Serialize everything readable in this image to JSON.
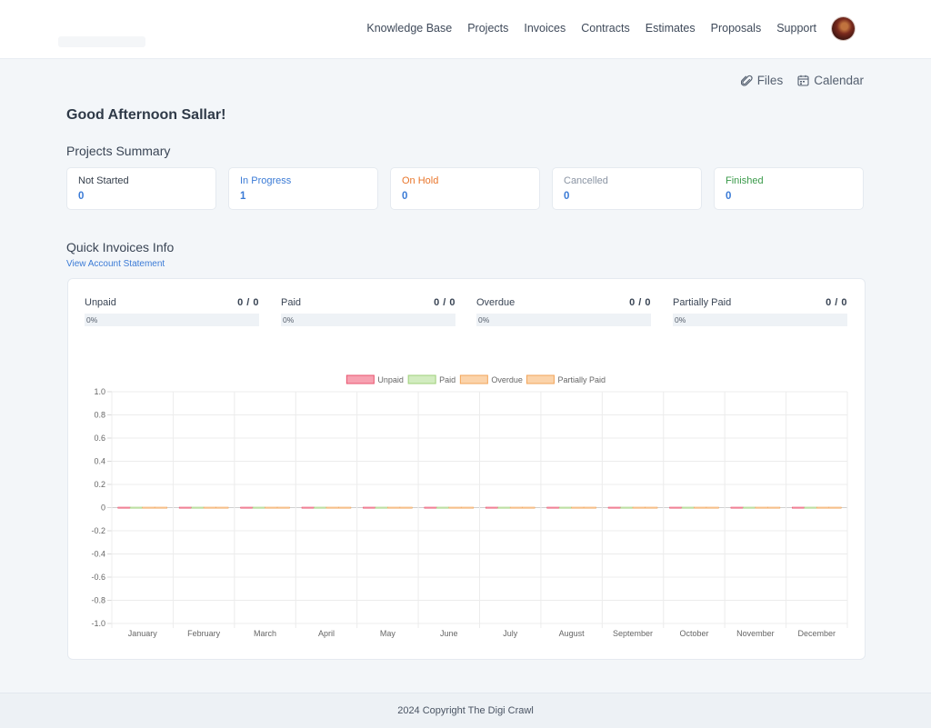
{
  "nav": {
    "items": [
      "Knowledge Base",
      "Projects",
      "Invoices",
      "Contracts",
      "Estimates",
      "Proposals",
      "Support"
    ]
  },
  "quicklinks": {
    "files": "Files",
    "calendar": "Calendar"
  },
  "greeting": "Good Afternoon Sallar!",
  "projects": {
    "title": "Projects Summary",
    "cards": [
      {
        "label": "Not Started",
        "value": "0",
        "color": "#333d4a"
      },
      {
        "label": "In Progress",
        "value": "1",
        "color": "#3b7bd6"
      },
      {
        "label": "On Hold",
        "value": "0",
        "color": "#e9762b"
      },
      {
        "label": "Cancelled",
        "value": "0",
        "color": "#8a94a3"
      },
      {
        "label": "Finished",
        "value": "0",
        "color": "#3a9a4a"
      }
    ]
  },
  "invoices": {
    "title": "Quick Invoices Info",
    "statement_link": "View Account Statement",
    "stats": [
      {
        "label": "Unpaid",
        "count": "0 / 0",
        "percent": "0%",
        "fraction": 0
      },
      {
        "label": "Paid",
        "count": "0 / 0",
        "percent": "0%",
        "fraction": 0
      },
      {
        "label": "Overdue",
        "count": "0 / 0",
        "percent": "0%",
        "fraction": 0
      },
      {
        "label": "Partially Paid",
        "count": "0 / 0",
        "percent": "0%",
        "fraction": 0
      }
    ]
  },
  "chart_data": {
    "type": "bar",
    "categories": [
      "January",
      "February",
      "March",
      "April",
      "May",
      "June",
      "July",
      "August",
      "September",
      "October",
      "November",
      "December"
    ],
    "series": [
      {
        "name": "Unpaid",
        "values": [
          0,
          0,
          0,
          0,
          0,
          0,
          0,
          0,
          0,
          0,
          0,
          0
        ],
        "color": "#f7a1b1",
        "border": "#e8546f"
      },
      {
        "name": "Paid",
        "values": [
          0,
          0,
          0,
          0,
          0,
          0,
          0,
          0,
          0,
          0,
          0,
          0
        ],
        "color": "#d2ecc0",
        "border": "#9fd07a"
      },
      {
        "name": "Overdue",
        "values": [
          0,
          0,
          0,
          0,
          0,
          0,
          0,
          0,
          0,
          0,
          0,
          0
        ],
        "color": "#fbd3aa",
        "border": "#f2a55b"
      },
      {
        "name": "Partially Paid",
        "values": [
          0,
          0,
          0,
          0,
          0,
          0,
          0,
          0,
          0,
          0,
          0,
          0
        ],
        "color": "#fbd3aa",
        "border": "#f2a55b"
      }
    ],
    "yticks": [
      "1.0",
      "0.8",
      "0.6",
      "0.4",
      "0.2",
      "0",
      "-0.2",
      "-0.4",
      "-0.6",
      "-0.8",
      "-1.0"
    ],
    "ylim": [
      -1,
      1
    ],
    "grid": true,
    "legend": "top"
  },
  "footer": "2024 Copyright The Digi Crawl"
}
